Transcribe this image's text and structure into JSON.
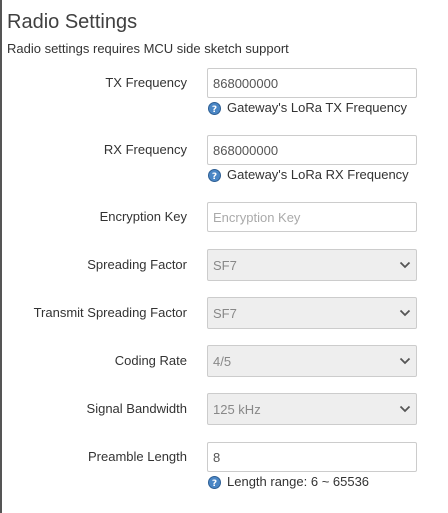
{
  "page": {
    "title": "Radio Settings",
    "description": "Radio settings requires MCU side sketch support"
  },
  "fields": {
    "tx_frequency": {
      "label": "TX Frequency",
      "value": "868000000",
      "help": "Gateway's LoRa TX Frequency"
    },
    "rx_frequency": {
      "label": "RX Frequency",
      "value": "868000000",
      "help": "Gateway's LoRa RX Frequency"
    },
    "encryption_key": {
      "label": "Encryption Key",
      "value": "",
      "placeholder": "Encryption Key"
    },
    "spreading_factor": {
      "label": "Spreading Factor",
      "selected": "SF7"
    },
    "transmit_spreading_factor": {
      "label": "Transmit Spreading Factor",
      "selected": "SF7"
    },
    "coding_rate": {
      "label": "Coding Rate",
      "selected": "4/5"
    },
    "signal_bandwidth": {
      "label": "Signal Bandwidth",
      "selected": "125 kHz"
    },
    "preamble_length": {
      "label": "Preamble Length",
      "value": "8",
      "help": "Length range: 6 ~ 65536"
    }
  },
  "icons": {
    "help": "help-question-icon",
    "dropdown": "chevron-down-icon"
  },
  "colors": {
    "help_icon_fill": "#4a86c5",
    "disabled_select_bg": "#eeeeee",
    "input_border": "#cccccc"
  }
}
